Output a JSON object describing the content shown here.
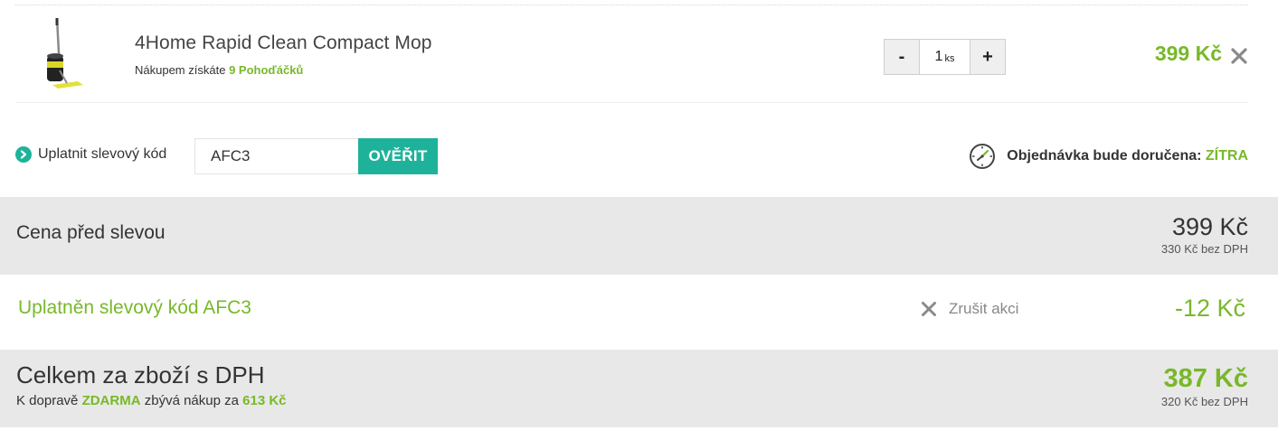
{
  "product": {
    "name": "4Home Rapid Clean Compact Mop",
    "points_prefix": "Nákupem získáte",
    "points_value": "9 Pohoďáčků",
    "quantity": "1",
    "quantity_unit": "ks",
    "minus_label": "-",
    "plus_label": "+",
    "price": "399 Kč"
  },
  "discount": {
    "toggle_label": "Uplatnit slevový kód",
    "code_value": "AFC3",
    "verify_label": "OVĚŘIT"
  },
  "delivery": {
    "label": "Objednávka bude doručena:",
    "value": "ZÍTRA"
  },
  "summary": {
    "before": {
      "label": "Cena před slevou",
      "price": "399 Kč",
      "price_without_vat": "330 Kč bez DPH"
    },
    "applied": {
      "label": "Uplatněn slevový kód AFC3",
      "cancel_label": "Zrušit akci",
      "amount": "-12 Kč"
    },
    "total": {
      "label": "Celkem za zboží s DPH",
      "shipping_prefix": "K dopravě",
      "shipping_free": "ZDARMA",
      "shipping_middle": "zbývá nákup za",
      "shipping_remaining": "613 Kč",
      "price": "387 Kč",
      "price_without_vat": "320 Kč bez DPH"
    }
  },
  "colors": {
    "accent_green": "#78b82a",
    "teal": "#1fb29b",
    "row_gray": "#e8e8e8"
  },
  "icons": {
    "remove": "close-icon",
    "toggle": "chevron-right-circle-icon",
    "delivery": "clock-icon",
    "cancel": "close-icon"
  }
}
